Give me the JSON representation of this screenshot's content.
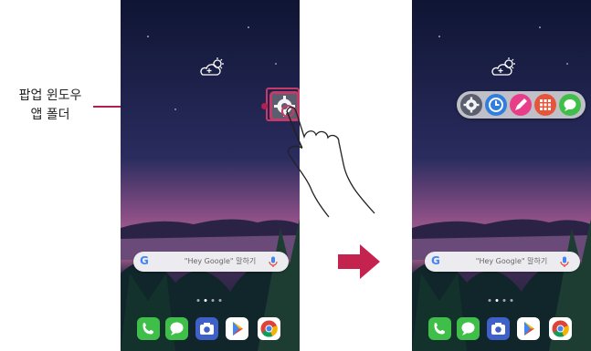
{
  "callout": {
    "line1": "팝업 윈도우",
    "line2": "앱 폴더"
  },
  "search": {
    "logo": "G",
    "placeholder": "\"Hey Google\" 말하기"
  },
  "icons": {
    "weather": "weather-icon",
    "mic": "mic-icon",
    "settings": "settings-gear-icon",
    "clock": "clock-icon",
    "pen": "pen-icon",
    "calendar": "calendar-icon",
    "messages": "messages-icon",
    "phone": "phone-icon",
    "camera": "camera-icon",
    "play": "play-store-icon",
    "chrome": "chrome-icon",
    "arrow": "arrow-right-icon",
    "hand": "hand-pointer-icon"
  },
  "colors": {
    "accent": "#b01f4d",
    "phone_app": "#3fbf4a",
    "messages_app": "#3fbf4a",
    "camera_app": "#3f5fc9",
    "play_app": "#ffffff",
    "clock_app": "#2f7ee0",
    "pen_app": "#e83e8a",
    "calendar_app": "#e8543a"
  }
}
